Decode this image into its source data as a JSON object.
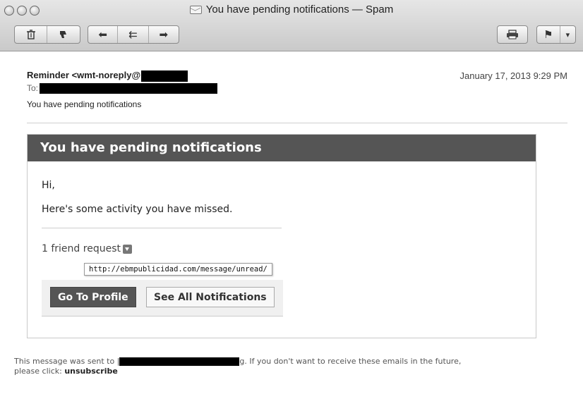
{
  "window": {
    "title": "You have pending notifications — Spam"
  },
  "toolbar": {
    "delete_icon": "trash-icon",
    "junk_icon": "thumbs-down-icon",
    "reply_glyph": "⬅",
    "reply_all_glyph": "⇇",
    "forward_glyph": "➡",
    "print_icon": "printer-icon",
    "flag_glyph": "⚑",
    "flag_menu_glyph": "▾"
  },
  "message": {
    "from": "Reminder <wmt-noreply@",
    "to_label": "To:",
    "subject": "You have pending notifications",
    "date": "January 17, 2013  9:29 PM"
  },
  "email": {
    "heading": "You have pending notifications",
    "greeting": "Hi,",
    "intro": "Here's some activity you have missed.",
    "friend_request": "1 friend request",
    "tooltip_url": "http://ebmpublicidad.com/message/unread/",
    "go_to_profile": "Go To Profile",
    "see_all": "See All Notifications"
  },
  "footer": {
    "sent_to": "This message was sent to |",
    "after_redaction": "g. If you don't want to receive these emails in the future,",
    "please_click": "please click:",
    "unsubscribe": "unsubscribe"
  },
  "colors": {
    "header_bar": "#555555",
    "button_dark": "#555555",
    "redaction": "#000000"
  }
}
